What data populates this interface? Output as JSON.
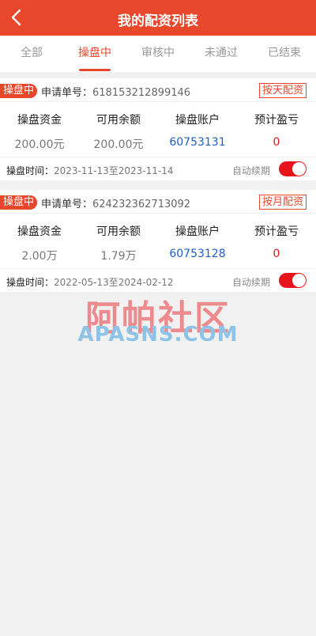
{
  "header": {
    "title": "我的配资列表",
    "back_icon": "chevron-left-icon"
  },
  "tabs": [
    {
      "label": "全部",
      "active": false
    },
    {
      "label": "操盘中",
      "active": true
    },
    {
      "label": "审核中",
      "active": false
    },
    {
      "label": "未通过",
      "active": false
    },
    {
      "label": "已结束",
      "active": false
    }
  ],
  "colors": {
    "accent": "#e8472b",
    "link": "#1f5fc4",
    "profit": "#e8141b"
  },
  "orders": [
    {
      "status": "操盘中",
      "order_label": "申请单号：",
      "order_no": "618153212899146",
      "plan": "按天配资",
      "columns": [
        "操盘资金",
        "可用余额",
        "操盘账户",
        "预计盈亏"
      ],
      "values": [
        "200.00元",
        "200.00元",
        "60753131",
        "0"
      ],
      "period_label": "操盘时间：",
      "period": "2023-11-13至2023-11-14",
      "auto_renew_label": "自动续期",
      "auto_renew": true
    },
    {
      "status": "操盘中",
      "order_label": "申请单号：",
      "order_no": "624232362713092",
      "plan": "按月配资",
      "columns": [
        "操盘资金",
        "可用余额",
        "操盘账户",
        "预计盈亏"
      ],
      "values": [
        "2.00万",
        "1.79万",
        "60753128",
        "0"
      ],
      "period_label": "操盘时间：",
      "period": "2022-05-13至2024-02-12",
      "auto_renew_label": "自动续期",
      "auto_renew": true
    }
  ],
  "watermark": {
    "cn": "阿帕社区",
    "en": "APASNS.COM"
  }
}
